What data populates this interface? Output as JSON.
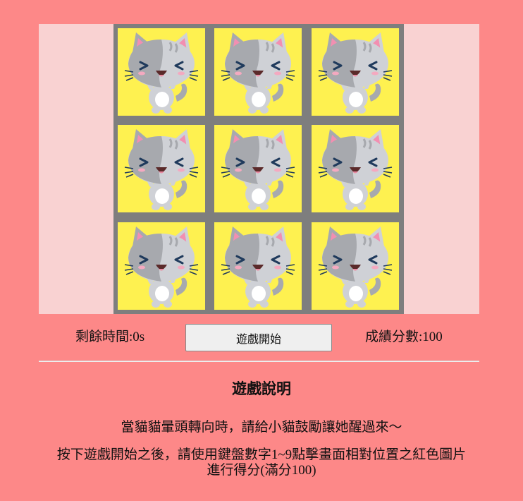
{
  "game": {
    "board": {
      "rows": 3,
      "cols": 3,
      "cells": [
        {
          "index": 1,
          "icon": "cat-icon",
          "state": "normal"
        },
        {
          "index": 2,
          "icon": "cat-icon",
          "state": "normal"
        },
        {
          "index": 3,
          "icon": "cat-icon",
          "state": "normal"
        },
        {
          "index": 4,
          "icon": "cat-icon",
          "state": "normal"
        },
        {
          "index": 5,
          "icon": "cat-icon",
          "state": "normal"
        },
        {
          "index": 6,
          "icon": "cat-icon",
          "state": "normal"
        },
        {
          "index": 7,
          "icon": "cat-icon",
          "state": "normal"
        },
        {
          "index": 8,
          "icon": "cat-icon",
          "state": "normal"
        },
        {
          "index": 9,
          "icon": "cat-icon",
          "state": "normal"
        }
      ]
    },
    "time_text": "剩餘時間:0s",
    "start_label": "遊戲開始",
    "score_text": "成績分數:100"
  },
  "instructions": {
    "title": "遊戲說明",
    "line1": "當貓貓暈頭轉向時，請給小貓鼓勵讓她醒過來〜",
    "line2a": "按下遊戲開始之後，請使用鍵盤數字1~9點擊畫面相對位置之紅色圖片",
    "line2b": "進行得分(滿分100)"
  },
  "colors": {
    "page_bg": "#fd8888",
    "stage_bg": "#f9d2d2",
    "board_bg": "#7e7e7e",
    "cell_bg": "#fef150",
    "cat_gray": "#a7a9ae",
    "cat_light": "#cfd1d6",
    "ear_pink": "#f28fb1",
    "eye_dark": "#1f3a5c"
  }
}
